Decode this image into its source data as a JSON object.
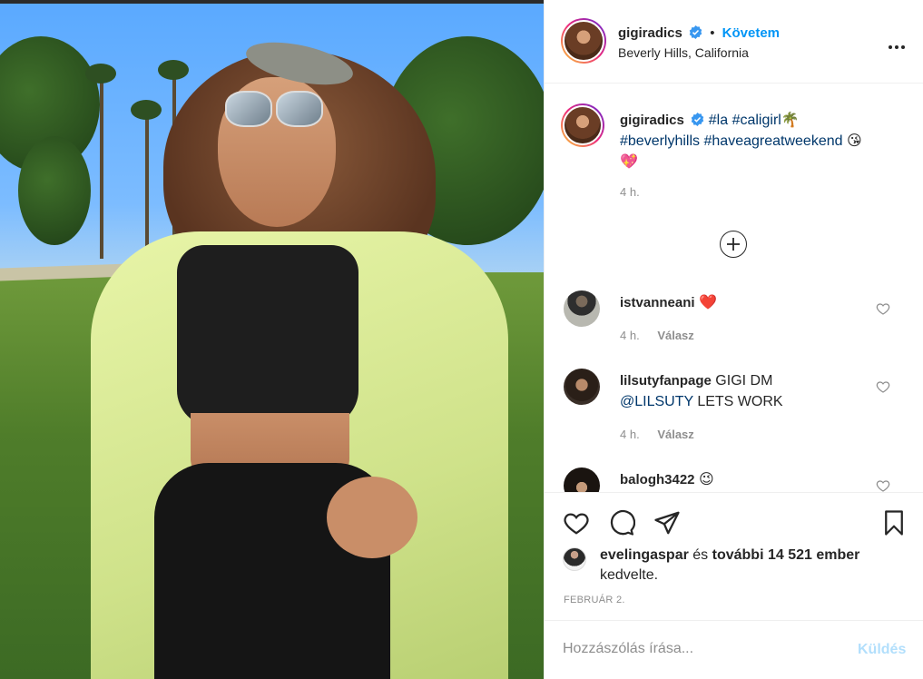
{
  "post": {
    "username": "gigiradics",
    "separator": "•",
    "follow_label": "Követem",
    "location": "Beverly Hills, California",
    "more_label": "•••"
  },
  "caption": {
    "username": "gigiradics",
    "hashtags": [
      "#la",
      "#caligirl",
      "#beverlyhills",
      "#haveagreatweekend"
    ],
    "emoji_palm": "🌴",
    "emoji_wink_kiss": "😘",
    "emoji_hearts": "💖",
    "time": "4 h.",
    "load_more_label": "+"
  },
  "comments": [
    {
      "username": "istvanneani",
      "text": "",
      "emoji": "❤️",
      "time": "4 h.",
      "reply_label": "Válasz"
    },
    {
      "username": "lilsutyfanpage",
      "text": " GIGI DM",
      "mention": "@LILSUTY",
      "text2": " LETS WORK",
      "time": "4 h.",
      "reply_label": "Válasz"
    },
    {
      "username": "balogh3422",
      "text": " ",
      "emoji": "😉"
    }
  ],
  "likes": {
    "first_liker": "evelingaspar",
    "connector": " és ",
    "others": "további 14 521 ember",
    "suffix": " kedvelte."
  },
  "date": "FEBRUÁR 2.",
  "comment_box": {
    "placeholder": "Hozzászólás írása...",
    "send_label": "Küldés"
  },
  "colors": {
    "accent": "#0095f6",
    "hashtag": "#00376b",
    "muted": "#8e8e8e",
    "send_disabled": "#b2dffc"
  }
}
